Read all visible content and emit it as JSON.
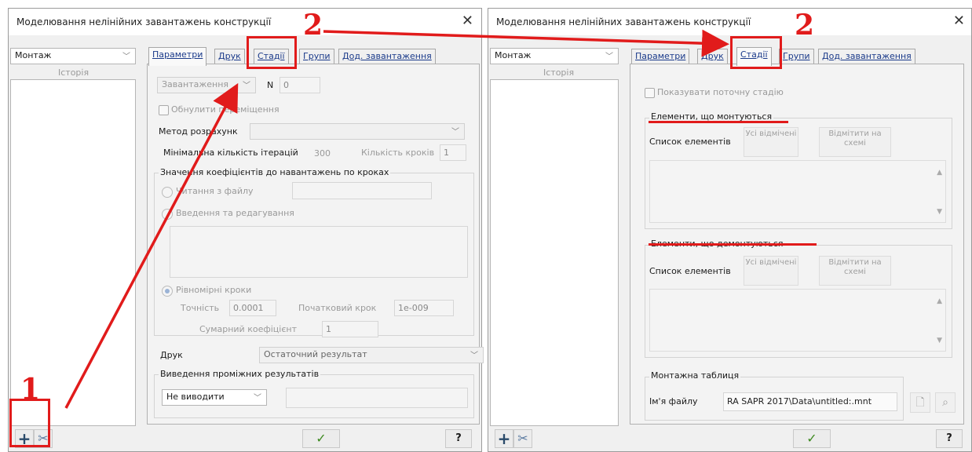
{
  "left": {
    "title": "Моделювання нелінійних завантажень конструкції",
    "close": "✕",
    "combo": "Монтаж",
    "history_label": "Історія",
    "tabs": [
      "Параметри",
      "Друк",
      "Стадії",
      "Групи",
      "Дод. завантаження"
    ],
    "load_combo": "Завантаження",
    "n_label": "N",
    "n_value": "0",
    "reset_label": "Обнулити переміщення",
    "method_label": "Метод розрахунк",
    "min_iter_label": "Мінімальна кількість ітерацій",
    "min_iter_value": "300",
    "steps_label": "Кількість кроків",
    "steps_value": "1",
    "coef_group_label": "Значення коефіцієнтів до навантажень по кроках",
    "read_file_label": "Читання з файлу",
    "edit_label": "Введення та редагування",
    "uniform_label": "Рівномірні кроки",
    "accuracy_label": "Точність",
    "accuracy_value": "0.0001",
    "init_step_label": "Початковий крок",
    "init_step_value": "1e-009",
    "sum_coef_label": "Сумарний коефіцієнт",
    "sum_coef_value": "1",
    "print_label": "Друк",
    "print_value": "Остаточний результат",
    "intermediate_label": "Виведення проміжних результатів",
    "intermediate_value": "Не виводити",
    "ok": "✓",
    "help": "?"
  },
  "right": {
    "title": "Моделювання нелінійних завантажень конструкції",
    "close": "✕",
    "combo": "Монтаж",
    "history_label": "Історія",
    "tabs": [
      "Параметри",
      "Друк",
      "Стадії",
      "Групи",
      "Дод. завантаження"
    ],
    "show_stage_label": "Показувати поточну стадію",
    "mounted_group": "Елементи, що монтуються",
    "list_label": "Список елементів",
    "all_marked": "Усі відмічені",
    "mark_on_scheme": "Відмітити на схемі",
    "dismounted_group": "Елементи, що демонтуються",
    "mount_table_group": "Монтажна таблиця",
    "filename_label": "Ім'я файлу",
    "filename_value": "RA SAPR 2017\\Data\\untitled:.mnt",
    "ok": "✓",
    "help": "?"
  },
  "annotations": {
    "marker1": "1",
    "marker2_left": "2",
    "marker2_right": "2",
    "color": "#e11b1b"
  }
}
